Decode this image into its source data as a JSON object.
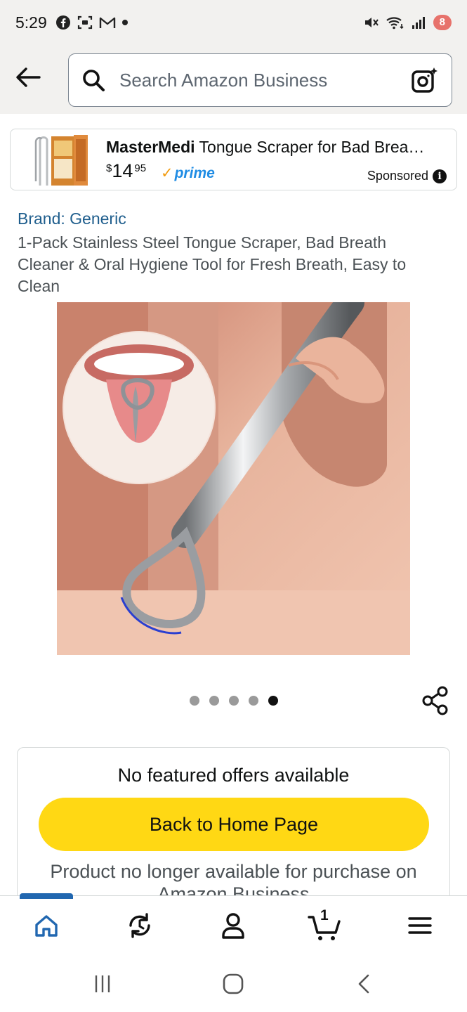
{
  "status_bar": {
    "time": "5:29",
    "battery": "8"
  },
  "search": {
    "placeholder": "Search Amazon Business"
  },
  "sponsored": {
    "brand": "MasterMedi",
    "title": " Tongue Scraper for Bad Brea…",
    "price_currency": "$",
    "price_whole": "14",
    "price_fraction": "95",
    "prime_label": "prime",
    "sponsored_label": "Sponsored"
  },
  "product": {
    "brand": "Brand: Generic",
    "title": "1-Pack Stainless Steel Tongue Scraper, Bad Breath Cleaner & Oral Hygiene Tool for Fresh Breath, Easy to Clean",
    "carousel_active_dot": 5,
    "carousel_dot_count": 5
  },
  "offers": {
    "heading": "No featured offers available",
    "home_button": "Back to Home Page",
    "unavailable": "Product no longer available for purchase on Amazon Business"
  },
  "bottom_nav": {
    "cart_count": "1",
    "active_tab": "home"
  },
  "colors": {
    "accent_button": "#ffd814",
    "link": "#1f5e8d",
    "prime_blue": "#1f8ce4",
    "nav_active": "#2167b0"
  }
}
